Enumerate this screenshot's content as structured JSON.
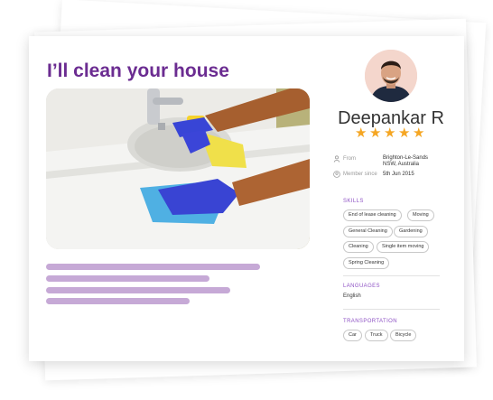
{
  "job": {
    "headline": "I’ll clean your house"
  },
  "profile": {
    "name": "Deepankar R",
    "rating": 5,
    "from_label": "From",
    "from_value_line1": "Brighton-Le-Sands",
    "from_value_line2": "NSW, Australia",
    "member_since_label": "Member since",
    "member_since_value": "5th Jun 2015"
  },
  "skills": {
    "title": "SKILLS",
    "items": [
      "End of lease cleaning",
      "Moving",
      "General Cleaning",
      "Gardening",
      "Cleaning",
      "Single item moving",
      "Spring Cleaning"
    ]
  },
  "languages": {
    "title": "LANGUAGES",
    "items": [
      "English"
    ]
  },
  "transportation": {
    "title": "TRANSPORTATION",
    "items": [
      "Car",
      "Truck",
      "Bicycle"
    ]
  },
  "description_lines": [
    0.94,
    0.72,
    0.81,
    0.63
  ],
  "colors": {
    "accent": "#6b2c91",
    "section": "#8e52c4",
    "star": "#f5a623",
    "glove": "#3b45d8",
    "placeholder": "#c6a9d6"
  },
  "icons": {
    "from": "person-icon",
    "member_since": "person-circle-icon",
    "star": "star-icon"
  }
}
